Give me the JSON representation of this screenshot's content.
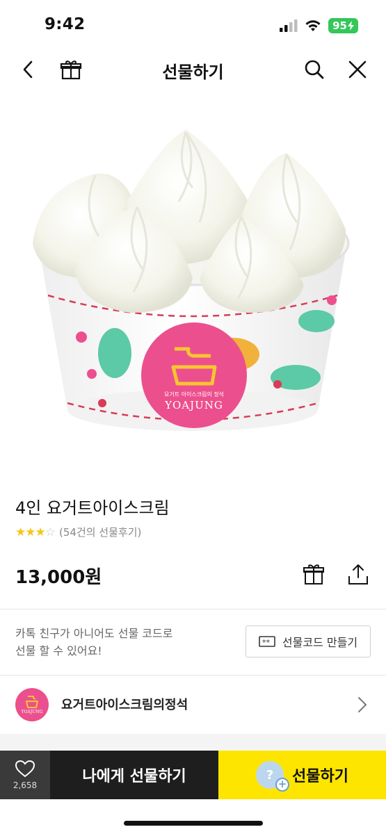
{
  "status_bar": {
    "time": "9:42",
    "battery": "95"
  },
  "nav": {
    "title": "선물하기",
    "icons": [
      "back-icon",
      "gift-box-icon",
      "search-icon",
      "close-icon"
    ]
  },
  "product": {
    "name": "4인 요거트아이스크림",
    "rating_stars": 3,
    "rating_max": 5,
    "review_count": "(54건의 선물후기)",
    "price": "13,000원",
    "cup_brand_caption": "요거트 아이스크림의 정석",
    "cup_brand_name": "YOAJUNG"
  },
  "gift_code": {
    "description_line1": "카톡 친구가 아니어도 선물 코드로",
    "description_line2": "선물 할 수 있어요!",
    "button_label": "선물코드 만들기"
  },
  "brand": {
    "name": "요거트아이스크림의정석",
    "logo_text": "YOAJUNG"
  },
  "bottom_bar": {
    "like_count": "2,658",
    "send_self_label": "나에게 선물하기",
    "send_gift_label": "선물하기"
  },
  "colors": {
    "kakao_yellow": "#fee500",
    "brand_pink": "#ec4f8d",
    "star": "#f5c518",
    "dark_button": "#1e1e1e"
  }
}
